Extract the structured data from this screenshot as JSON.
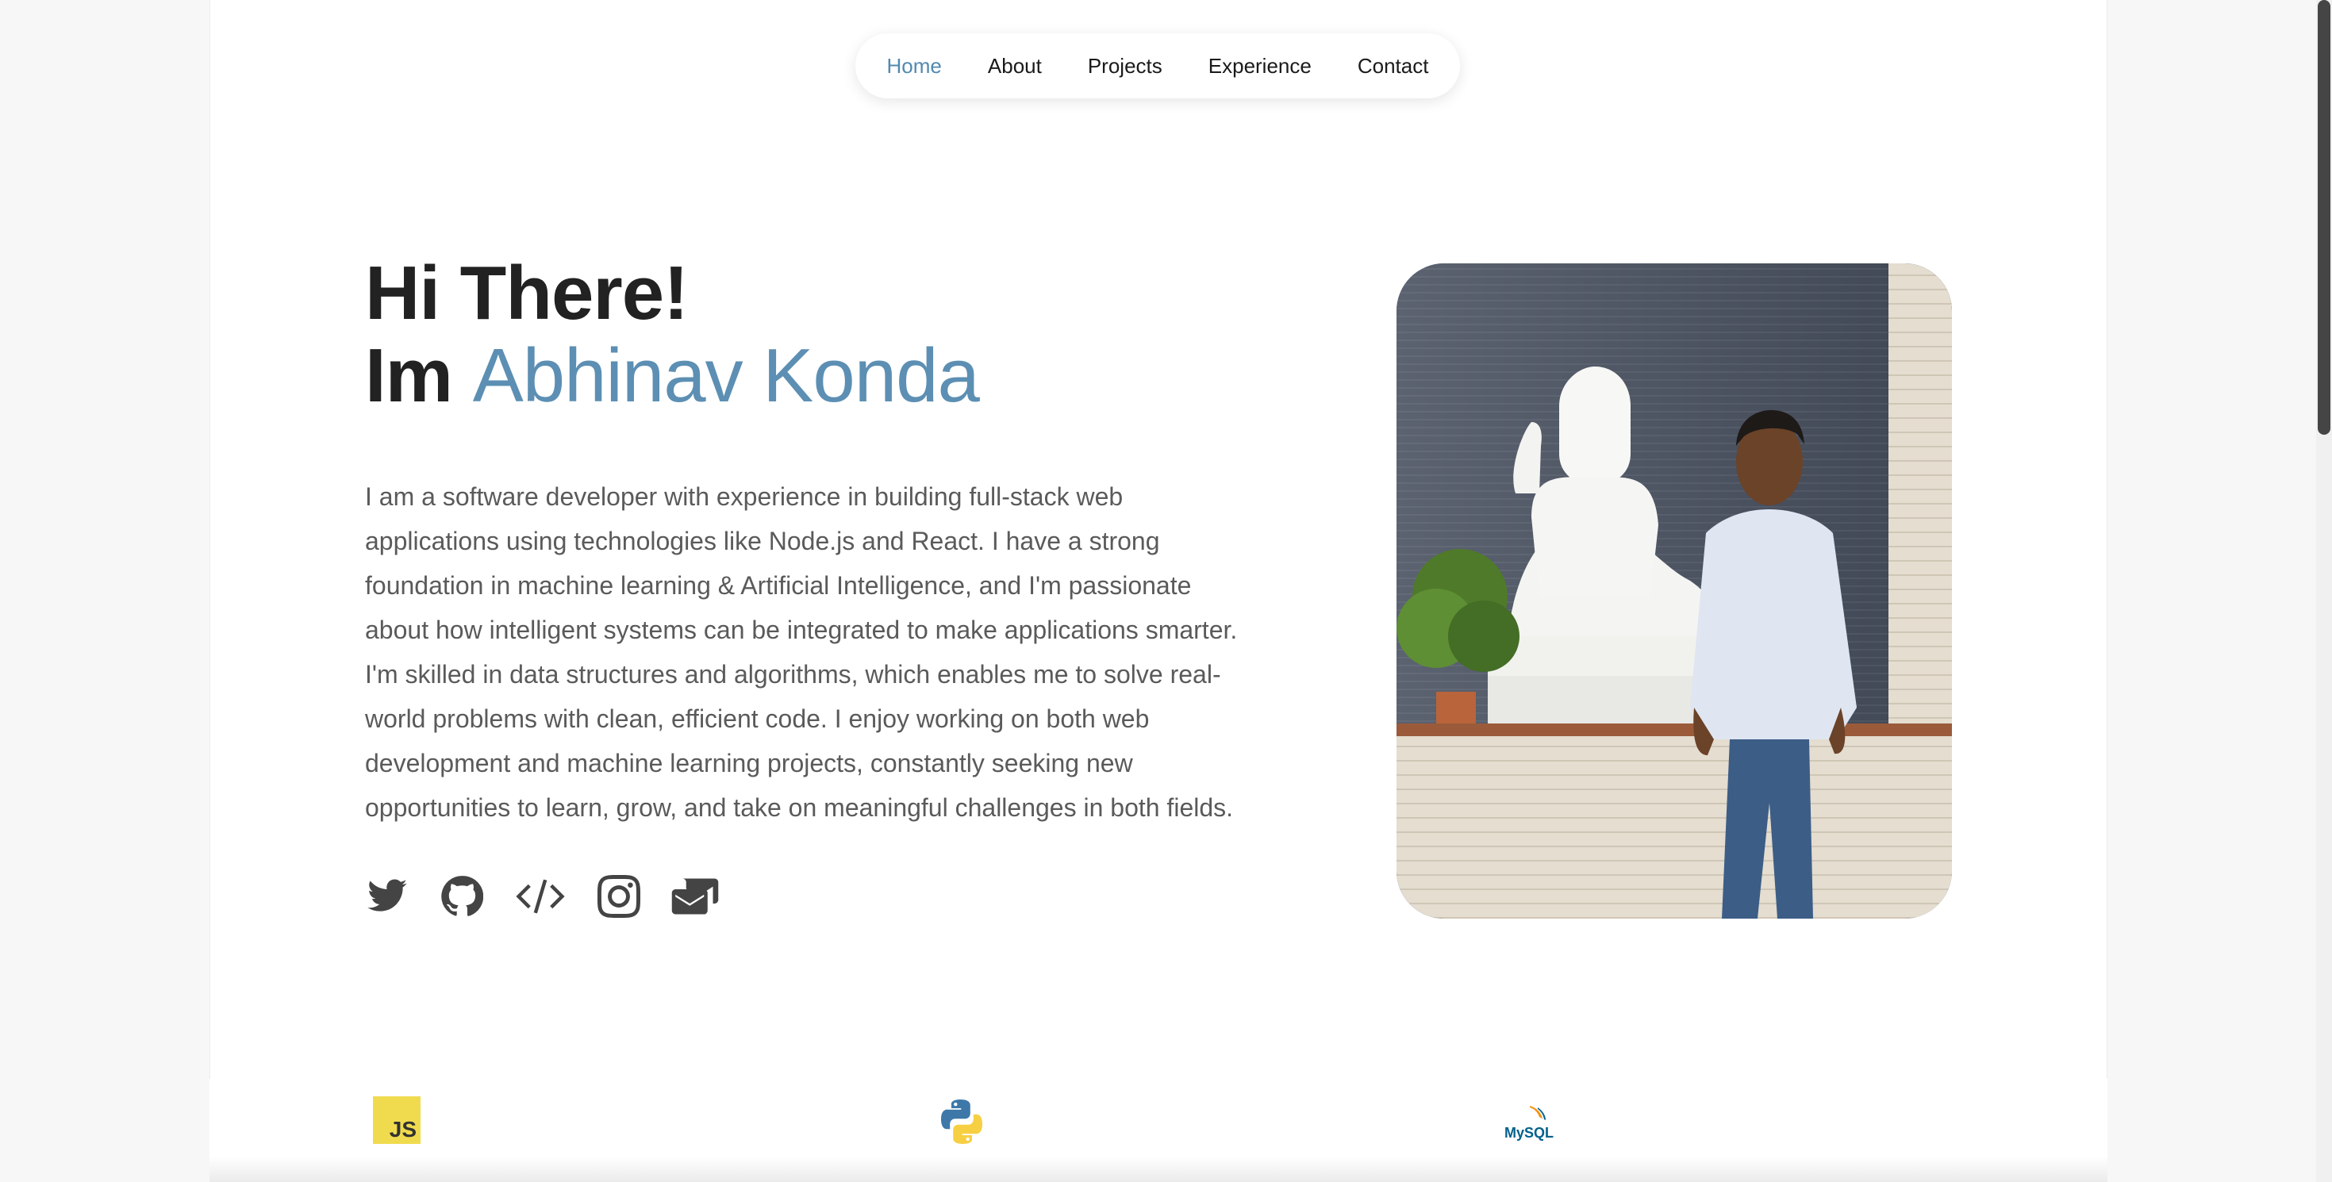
{
  "nav": {
    "items": [
      {
        "label": "Home",
        "active": true
      },
      {
        "label": "About"
      },
      {
        "label": "Projects"
      },
      {
        "label": "Experience"
      },
      {
        "label": "Contact"
      }
    ]
  },
  "hero": {
    "greeting": "Hi There!",
    "intro_prefix": "Im ",
    "name": "Abhinav Konda",
    "bio": "I am a software developer with experience in building full-stack web applications using technologies like Node.js and React. I have a strong foundation in machine learning & Artificial Intelligence, and I'm passionate about how intelligent systems can be integrated to make applications smarter. I'm skilled in data structures and algorithms, which enables me to solve real-world problems with clean, efficient code. I enjoy working on both web development and machine learning projects, constantly seeking new opportunities to learn, grow, and take on meaningful challenges in both fields."
  },
  "socials": [
    {
      "icon": "twitter-icon"
    },
    {
      "icon": "github-icon"
    },
    {
      "icon": "code-icon"
    },
    {
      "icon": "instagram-icon"
    },
    {
      "icon": "mail-icon"
    }
  ],
  "tech": {
    "js_label": "JS",
    "mysql_label": "MySQL"
  },
  "colors": {
    "accent": "#5c8fb3",
    "nav_active": "#5289b0",
    "text": "#222222",
    "body_text": "#5a5a5a"
  }
}
